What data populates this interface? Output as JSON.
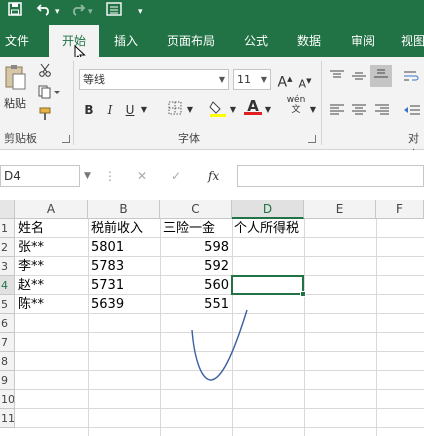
{
  "app": {
    "accent": "#217346"
  },
  "qat": {
    "save_icon": "save-icon",
    "undo_icon": "undo-icon",
    "redo_icon": "redo-icon",
    "form_icon": "form-icon",
    "customize": "▾"
  },
  "tabs": [
    "文件",
    "开始",
    "插入",
    "页面布局",
    "公式",
    "数据",
    "审阅",
    "视图"
  ],
  "active_tab": "开始",
  "ribbon": {
    "clipboard": {
      "label": "剪贴板",
      "paste": "粘贴"
    },
    "font": {
      "label": "字体",
      "font_name": "等线",
      "font_size": "11",
      "bold": "B",
      "italic": "I",
      "underline": "U",
      "grow": "A",
      "shrink": "A",
      "phonetic": "wén"
    },
    "align": {
      "label": "对齐"
    }
  },
  "formula_bar": {
    "name_box": "D4",
    "cancel": "✕",
    "enter": "✓",
    "fx": "fx",
    "value": ""
  },
  "columns": [
    "A",
    "B",
    "C",
    "D",
    "E",
    "F"
  ],
  "selected_column": "D",
  "rows": [
    "1",
    "2",
    "3",
    "4",
    "5",
    "6",
    "7",
    "8",
    "9",
    "10",
    "11"
  ],
  "selected_row": "4",
  "sheet": {
    "headers": [
      "姓名",
      "税前收入",
      "三险一金",
      "个人所得税"
    ],
    "data": [
      [
        "张**",
        "5801",
        "598"
      ],
      [
        "李**",
        "5783",
        "592"
      ],
      [
        "赵**",
        "5731",
        "560"
      ],
      [
        "陈**",
        "5639",
        "551"
      ]
    ]
  }
}
